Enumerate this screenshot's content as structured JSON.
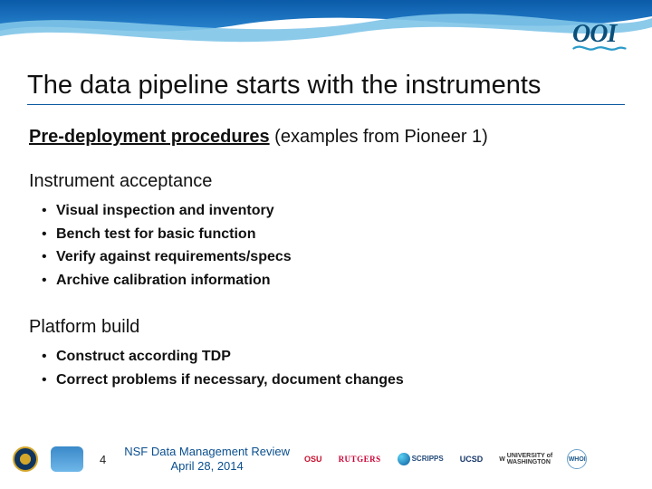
{
  "header": {
    "logo_text": "OOI"
  },
  "title": "The data pipeline starts with the instruments",
  "subtitle": {
    "underlined": "Pre-deployment procedures",
    "rest": " (examples from Pioneer 1)"
  },
  "sections": [
    {
      "heading": "Instrument acceptance",
      "items": [
        "Visual inspection and inventory",
        "Bench test for basic function",
        "Verify against requirements/specs",
        "Archive calibration information"
      ]
    },
    {
      "heading": "Platform build",
      "items": [
        "Construct according TDP",
        "Correct problems if necessary, document changes"
      ]
    }
  ],
  "footer": {
    "page_number": "4",
    "review_line1": "NSF Data Management Review",
    "review_line2": "April 28, 2014",
    "partners": {
      "osu": "OSU",
      "rutgers": "RUTGERS",
      "scripps": "SCRIPPS",
      "ucsd": "UCSD",
      "uw_line1": "UNIVERSITY of",
      "uw_line2": "WASHINGTON",
      "whoi": "WHOI"
    }
  }
}
